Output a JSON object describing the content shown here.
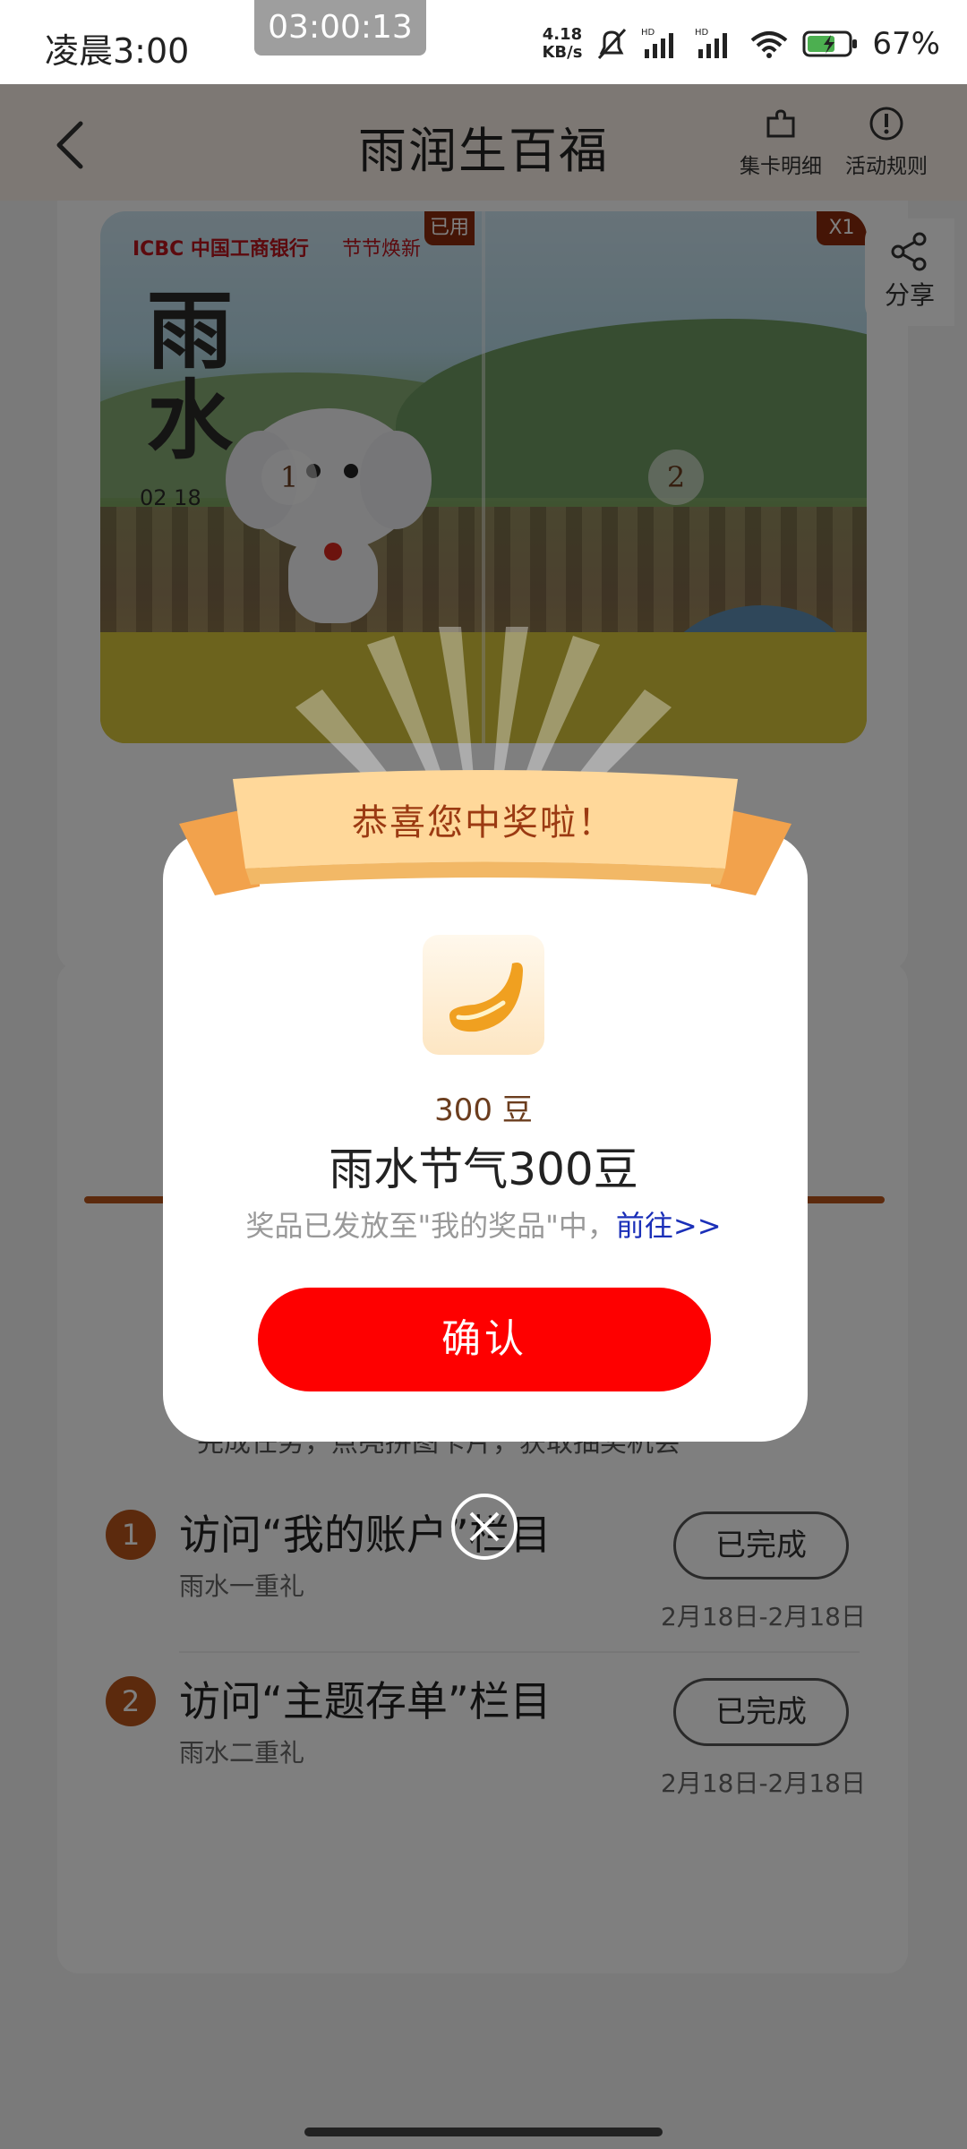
{
  "status_bar": {
    "time": "凌晨3:00",
    "recording": "03:00:13",
    "speed_value": "4.18",
    "speed_unit": "KB/s",
    "battery": "67%"
  },
  "nav": {
    "title": "雨润生百福",
    "collect_label": "集卡明细",
    "rules_label": "活动规则"
  },
  "share_label": "分享",
  "banner": {
    "brand": "ICBC 中国工商银行",
    "tag": "节节焕新",
    "headline": "雨水",
    "date_text": "02 18",
    "used_badge": "已用",
    "count_badge": "X1",
    "part_1": "1",
    "part_2": "2"
  },
  "tasks": {
    "hint": "完成任务，点亮拼图卡片，获取抽奖机会",
    "items": [
      {
        "num": "1",
        "title": "访问“我的账户”栏目",
        "subtitle": "雨水一重礼",
        "button": "已完成",
        "date": "2月18日-2月18日"
      },
      {
        "num": "2",
        "title": "访问“主题存单”栏目",
        "subtitle": "雨水二重礼",
        "button": "已完成",
        "date": "2月18日-2月18日"
      }
    ]
  },
  "modal": {
    "ribbon": "恭喜您中奖啦！",
    "prize_qty": "300 豆",
    "prize_name": "雨水节气300豆",
    "note": "奖品已发放至\"我的奖品\"中，",
    "link": "前往>>",
    "confirm": "确认"
  },
  "colors": {
    "confirm_red": "#fe0000",
    "task_orange": "#b8541a",
    "link_blue": "#1a2fb8"
  }
}
